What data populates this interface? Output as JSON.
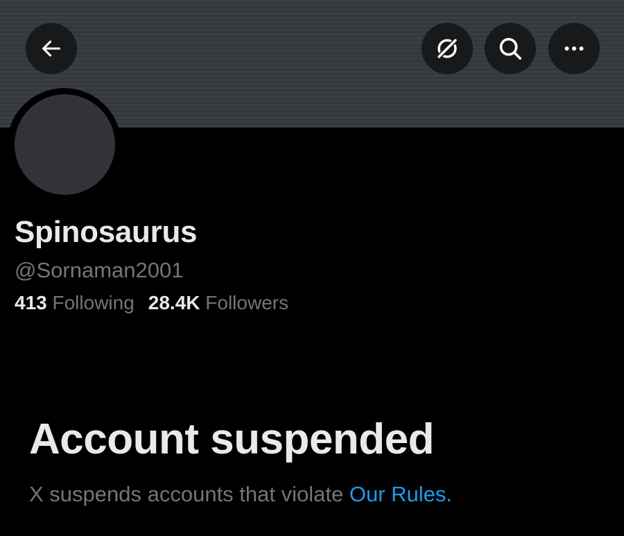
{
  "header": {
    "icons": [
      "back-arrow-icon",
      "grok-icon",
      "search-icon",
      "more-icon"
    ],
    "colors": {
      "banner": "#3a3d41",
      "button_bg": "#17191b",
      "icon": "#ffffff"
    }
  },
  "profile": {
    "display_name": "Spinosaurus",
    "handle": "@Sornaman2001",
    "following_count": "413",
    "following_label": "Following",
    "followers_count": "28.4K",
    "followers_label": "Followers"
  },
  "suspension": {
    "title": "Account suspended",
    "message": "X suspends accounts that violate ",
    "link_text": "Our Rules",
    "suffix": "."
  },
  "colors": {
    "background": "#000000",
    "primary_text": "#e7e9ea",
    "secondary_text": "#71767b",
    "link": "#1d9bf0"
  }
}
